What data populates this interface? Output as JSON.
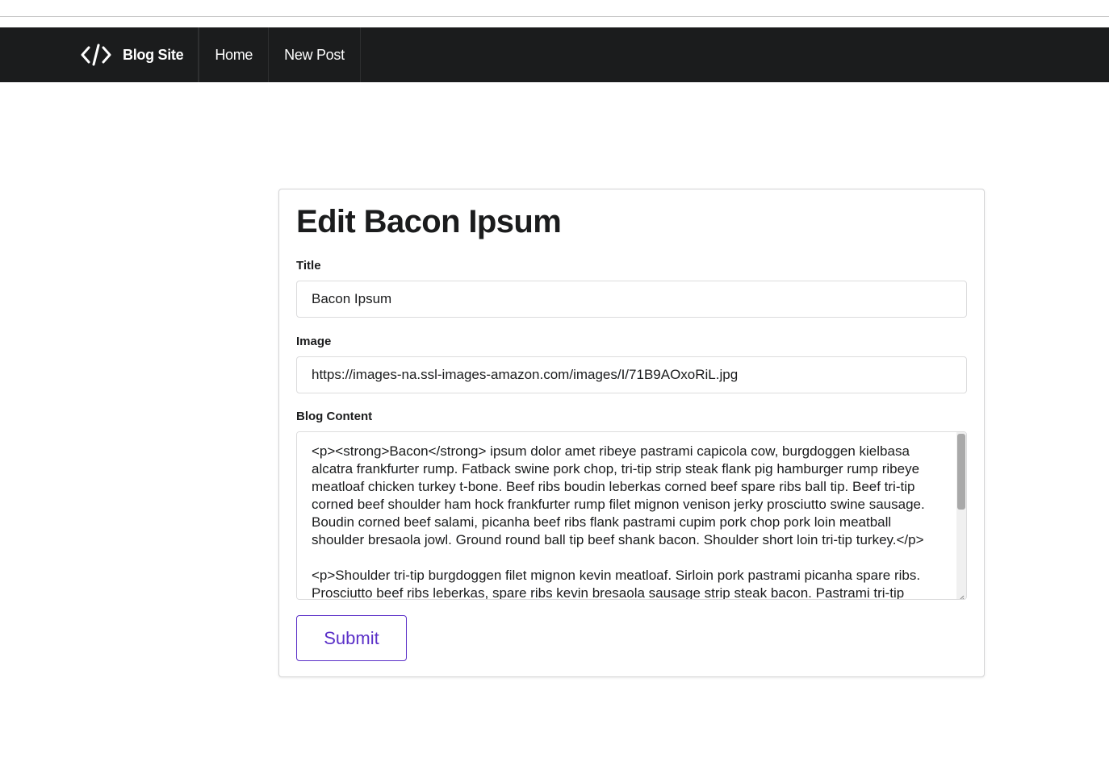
{
  "navbar": {
    "brand_label": "Blog Site",
    "brand_icon": "code-icon",
    "home_label": "Home",
    "new_post_label": "New Post"
  },
  "form": {
    "heading": "Edit Bacon Ipsum",
    "title_label": "Title",
    "title_value": "Bacon Ipsum",
    "image_label": "Image",
    "image_value": "https://images-na.ssl-images-amazon.com/images/I/71B9AOxoRiL.jpg",
    "content_label": "Blog Content",
    "content_value": "<p><strong>Bacon</strong> ipsum dolor amet ribeye pastrami capicola cow, burgdoggen kielbasa alcatra frankfurter rump. Fatback swine pork chop, tri-tip strip steak flank pig hamburger rump ribeye meatloaf chicken turkey t-bone. Beef ribs boudin leberkas corned beef spare ribs ball tip. Beef tri-tip corned beef shoulder ham hock frankfurter rump filet mignon venison jerky prosciutto swine sausage. Boudin corned beef salami, picanha beef ribs flank pastrami cupim pork chop pork loin meatball shoulder bresaola jowl. Ground round ball tip beef shank bacon. Shoulder short loin tri-tip turkey.</p>\n\n<p>Shoulder tri-tip burgdoggen filet mignon kevin meatloaf. Sirloin pork pastrami picanha spare ribs. Prosciutto beef ribs leberkas, spare ribs kevin bresaola sausage strip steak bacon. Pastrami tri-tip",
    "submit_label": "Submit"
  },
  "colors": {
    "navbar_bg": "#1b1c1d",
    "accent": "#5b30c8"
  }
}
